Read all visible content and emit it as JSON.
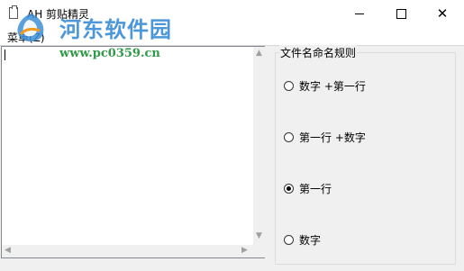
{
  "window": {
    "title": "AH 剪贴精灵",
    "minimize_icon": "minimize-icon",
    "maximize_icon": "maximize-icon",
    "close_icon": "close-icon",
    "close_glyph": "✕"
  },
  "watermark": {
    "title": "河东软件园",
    "url": "www.pc0359.cn"
  },
  "menu": {
    "items": [
      {
        "label": "菜单(Z)"
      }
    ]
  },
  "editor": {
    "value": ""
  },
  "naming_rules": {
    "legend": "文件名命名规则",
    "options": [
      {
        "label": "数字 +第一行",
        "checked": false
      },
      {
        "label": "第一行 +数字",
        "checked": false
      },
      {
        "label": "第一行",
        "checked": true
      },
      {
        "label": "数字",
        "checked": false
      }
    ]
  },
  "colors": {
    "watermark_title": "#3d8fd6",
    "watermark_url": "#2f9a47",
    "background": "#f0f0f0"
  }
}
